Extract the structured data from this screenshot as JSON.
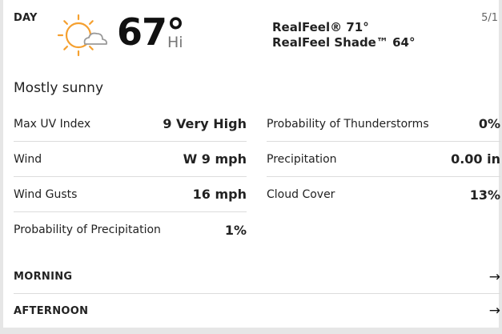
{
  "header": {
    "period": "DAY",
    "date": "5/1",
    "weather_icon": "sun-partly-cloudy-icon",
    "temperature": "67°",
    "temp_type": "Hi",
    "realfeel": "RealFeel® 71°",
    "realfeel_shade": "RealFeel Shade™ 64°"
  },
  "summary": "Mostly sunny",
  "details_left": [
    {
      "label": "Max UV Index",
      "value": "9 Very High"
    },
    {
      "label": "Wind",
      "value": "W 9 mph"
    },
    {
      "label": "Wind Gusts",
      "value": "16 mph"
    },
    {
      "label": "Probability of Precipitation",
      "value": "1%"
    }
  ],
  "details_right": [
    {
      "label": "Probability of Thunderstorms",
      "value": "0%"
    },
    {
      "label": "Precipitation",
      "value": "0.00 in"
    },
    {
      "label": "Cloud Cover",
      "value": "13%"
    }
  ],
  "sections": [
    {
      "label": "MORNING",
      "icon": "arrow-right-icon"
    },
    {
      "label": "AFTERNOON",
      "icon": "arrow-right-icon"
    }
  ],
  "colors": {
    "sun": "#f5a030",
    "cloud": "#9a9a9a",
    "background": "#e6e6e6"
  }
}
